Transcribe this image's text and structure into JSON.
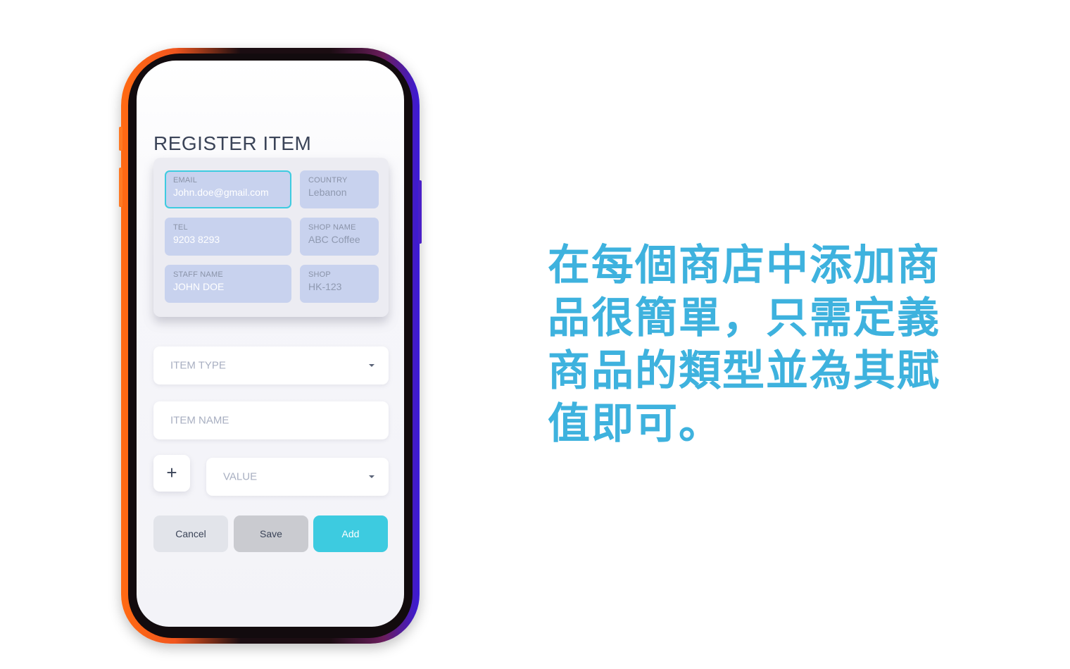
{
  "screen": {
    "title": "REGISTER ITEM",
    "info_card": {
      "email": {
        "label": "EMAIL",
        "value": "John.doe@gmail.com"
      },
      "country": {
        "label": "COUNTRY",
        "value": "Lebanon"
      },
      "tel": {
        "label": "TEL",
        "value": "9203 8293"
      },
      "shop_name": {
        "label": "SHOP NAME",
        "value": "ABC Coffee"
      },
      "staff_name": {
        "label": "STAFF NAME",
        "value": "JOHN DOE"
      },
      "shop": {
        "label": "SHOP",
        "value": "HK-123"
      }
    },
    "item_type": {
      "placeholder": "ITEM TYPE"
    },
    "item_name": {
      "placeholder": "ITEM NAME"
    },
    "add_value_button": {
      "label": "+"
    },
    "value_select": {
      "placeholder": "VALUE"
    },
    "buttons": {
      "cancel": "Cancel",
      "save": "Save",
      "add": "Add"
    }
  },
  "promo_text": "在每個商店中添加商品很簡單，只需定義商品的類型並為其賦值即可。",
  "colors": {
    "accent": "#3dcbe0",
    "promo_text": "#3eb2de",
    "field_bg": "#c8d2ee"
  }
}
